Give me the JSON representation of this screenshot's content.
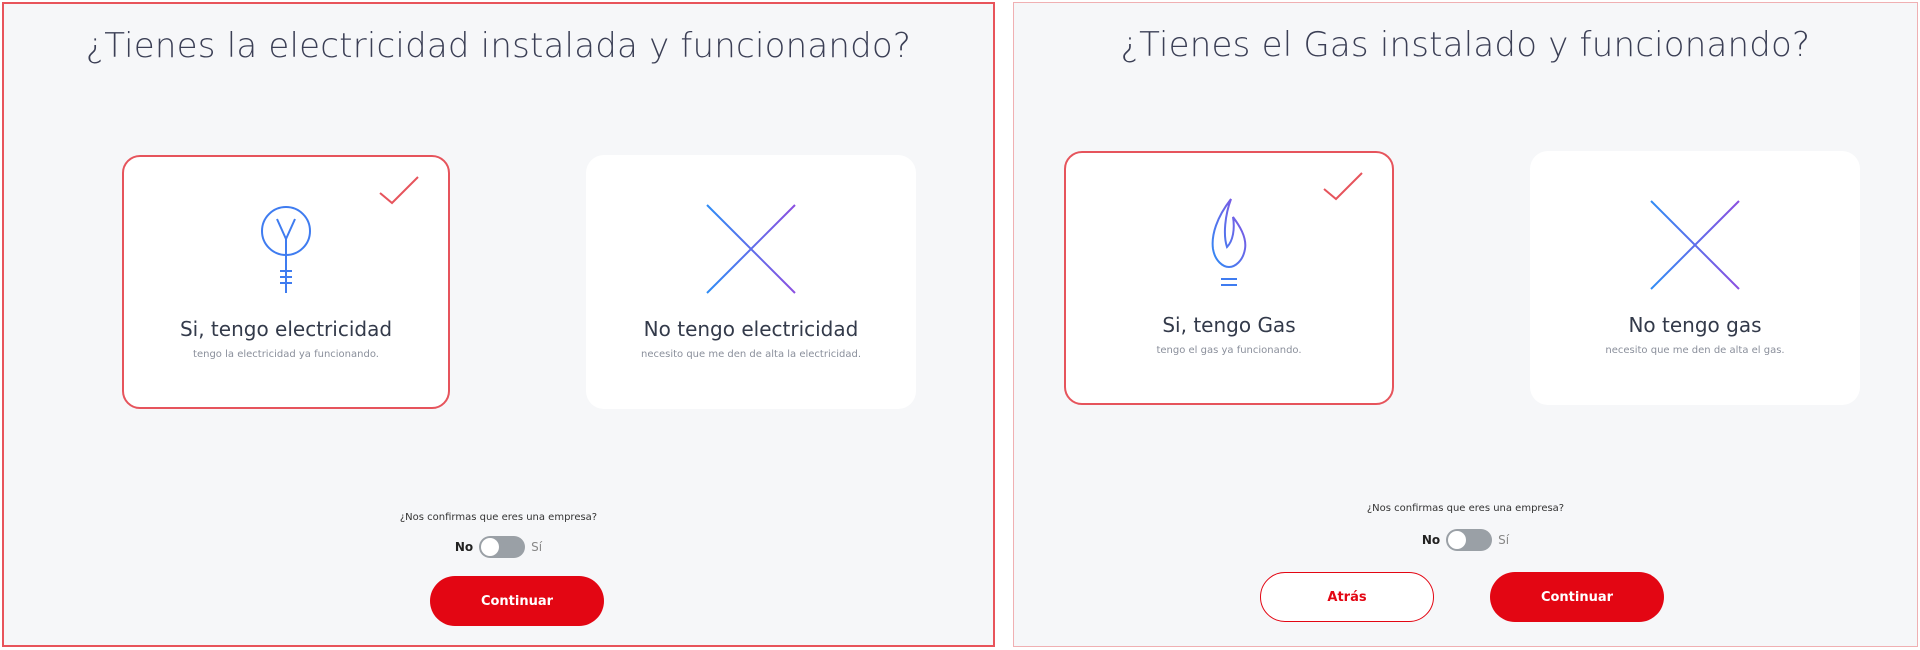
{
  "colors": {
    "accent": "#e30613",
    "selected_border": "#e6545c",
    "icon_blue": "#3f7cf0",
    "icon_purple": "#8a4fe0"
  },
  "left": {
    "title": "¿Tienes la electricidad instalada y funcionando?",
    "option_yes": {
      "icon": "lightbulb-icon",
      "title": "Si, tengo electricidad",
      "subtitle": "tengo la electricidad ya funcionando.",
      "selected": true
    },
    "option_no": {
      "icon": "x-icon",
      "title": "No tengo electricidad",
      "subtitle": "necesito que me den de alta la electricidad.",
      "selected": false
    },
    "company_question": "¿Nos confirmas que eres una empresa?",
    "toggle": {
      "no_label": "No",
      "si_label": "Sí",
      "value": "No"
    },
    "continue_label": "Continuar"
  },
  "right": {
    "title": "¿Tienes el Gas instalado y funcionando?",
    "option_yes": {
      "icon": "gas-flame-icon",
      "title": "Si, tengo Gas",
      "subtitle": "tengo el gas ya funcionando.",
      "selected": true
    },
    "option_no": {
      "icon": "x-icon",
      "title": "No tengo gas",
      "subtitle": "necesito que me den de alta el gas.",
      "selected": false
    },
    "company_question": "¿Nos confirmas que eres una empresa?",
    "toggle": {
      "no_label": "No",
      "si_label": "Sí",
      "value": "No"
    },
    "back_label": "Atrás",
    "continue_label": "Continuar"
  }
}
